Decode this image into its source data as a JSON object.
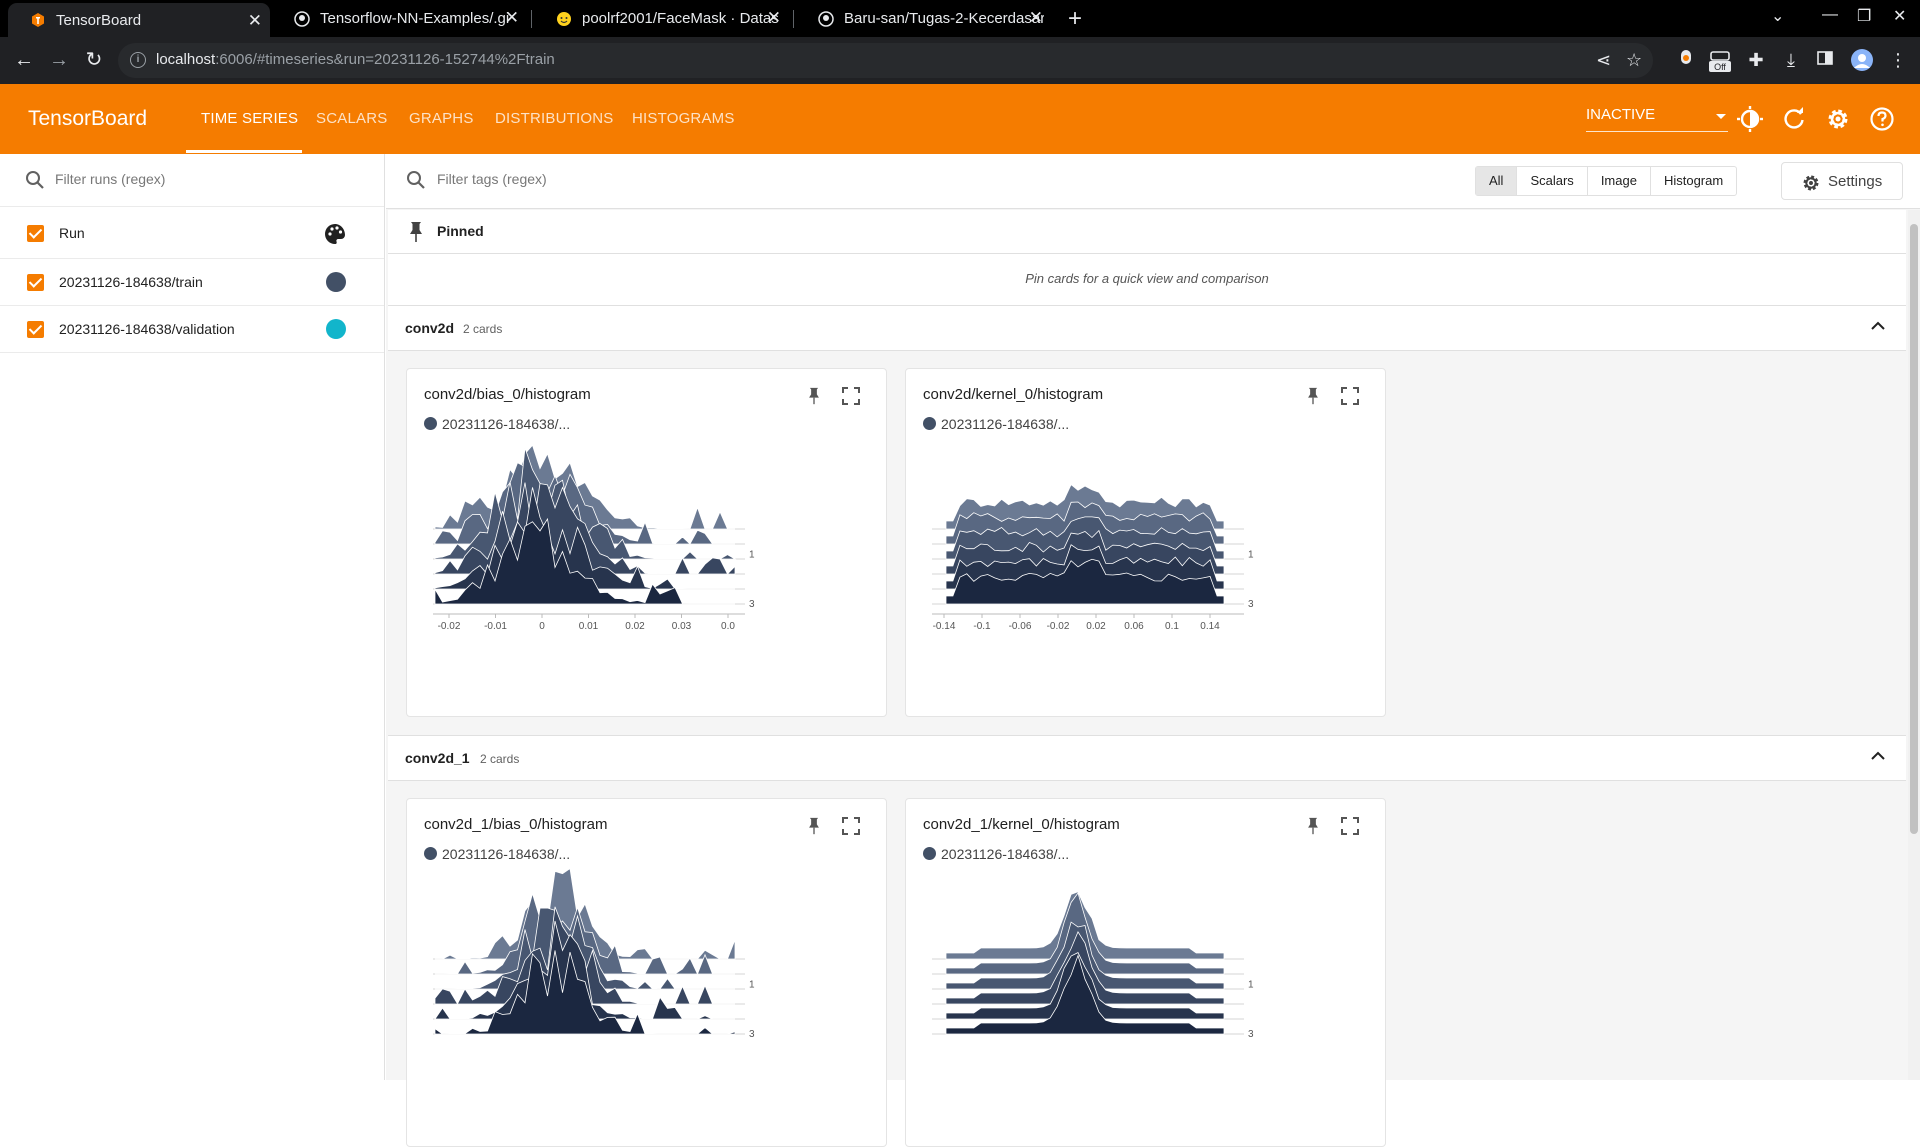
{
  "browser": {
    "tabs": [
      {
        "title": "TensorBoard",
        "icon": "tensorboard-icon",
        "active": true
      },
      {
        "title": "Tensorflow-NN-Examples/.gi",
        "icon": "github-icon",
        "active": false
      },
      {
        "title": "poolrf2001/FaceMask · Datas",
        "icon": "huggingface-icon",
        "active": false
      },
      {
        "title": "Baru-san/Tugas-2-Kecerdasar",
        "icon": "github-icon",
        "active": false
      }
    ],
    "url_host": "localhost",
    "url_rest": ":6006/#timeseries&run=20231126-152744%2Ftrain",
    "extension_badge": "Off"
  },
  "header": {
    "brand": "TensorBoard",
    "nav": [
      {
        "label": "TIME SERIES",
        "active": true
      },
      {
        "label": "SCALARS",
        "active": false
      },
      {
        "label": "GRAPHS",
        "active": false
      },
      {
        "label": "DISTRIBUTIONS",
        "active": false
      },
      {
        "label": "HISTOGRAMS",
        "active": false
      }
    ],
    "plugin_select": "INACTIVE",
    "accent_color": "#f57c00"
  },
  "runs_panel": {
    "filter_placeholder": "Filter runs (regex)",
    "header_label": "Run",
    "runs": [
      {
        "name": "20231126-184638/train",
        "color": "#425066",
        "checked": true
      },
      {
        "name": "20231126-184638/validation",
        "color": "#12b5cb",
        "checked": true
      }
    ]
  },
  "toolbar": {
    "filter_placeholder": "Filter tags (regex)",
    "type_filters": [
      "All",
      "Scalars",
      "Image",
      "Histogram"
    ],
    "selected_filter": "All",
    "settings_label": "Settings"
  },
  "pinned": {
    "title": "Pinned",
    "empty_message": "Pin cards for a quick view and comparison"
  },
  "groups": [
    {
      "name": "conv2d",
      "count": "2 cards",
      "cards": [
        {
          "title": "conv2d/bias_0/histogram",
          "run": "20231126-184638/...",
          "xticks": [
            "-0.02",
            "-0.01",
            "0",
            "0.01",
            "0.02",
            "0.03",
            "0.0"
          ],
          "yticks": [
            "1",
            "3"
          ]
        },
        {
          "title": "conv2d/kernel_0/histogram",
          "run": "20231126-184638/...",
          "xticks": [
            "-0.14",
            "-0.1",
            "-0.06",
            "-0.02",
            "0.02",
            "0.06",
            "0.1",
            "0.14"
          ],
          "yticks": [
            "1",
            "3"
          ]
        }
      ]
    },
    {
      "name": "conv2d_1",
      "count": "2 cards",
      "cards": [
        {
          "title": "conv2d_1/bias_0/histogram",
          "run": "20231126-184638/...",
          "xticks": [],
          "yticks": [
            "1",
            "3"
          ]
        },
        {
          "title": "conv2d_1/kernel_0/histogram",
          "run": "20231126-184638/...",
          "xticks": [],
          "yticks": [
            "1",
            "3"
          ]
        }
      ]
    }
  ]
}
